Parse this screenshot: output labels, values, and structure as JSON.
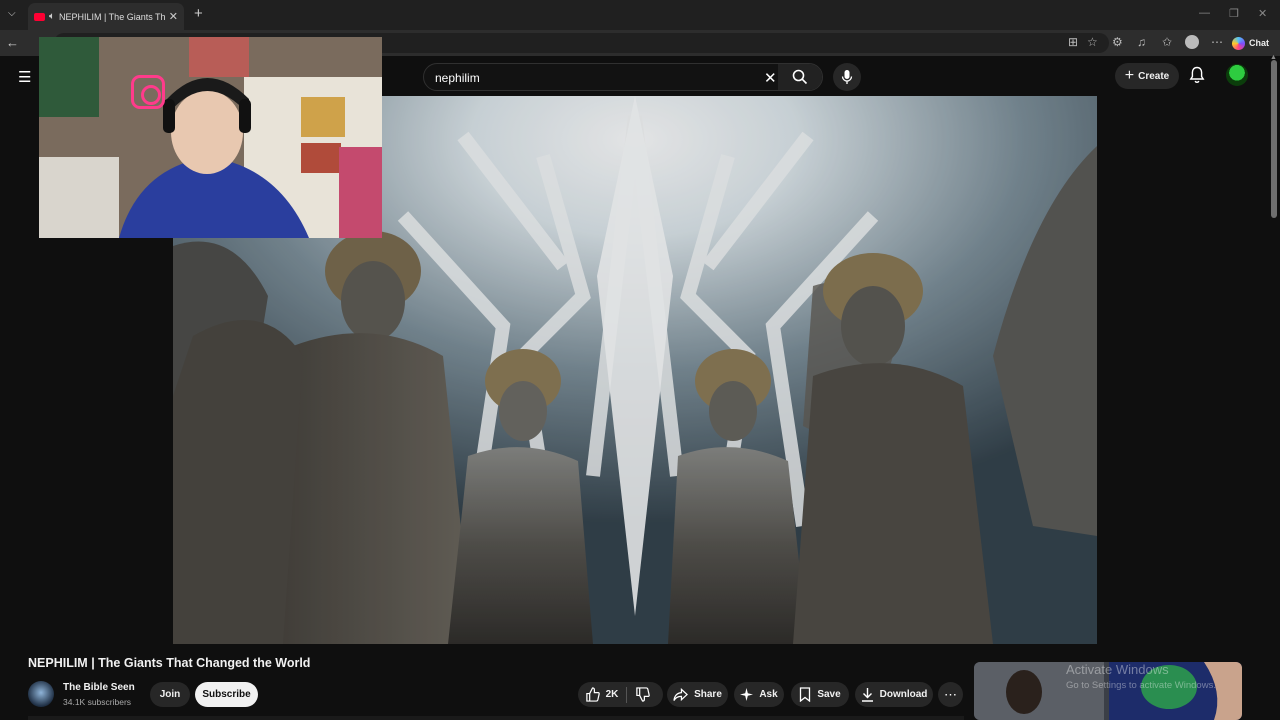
{
  "browser": {
    "tab_title": "NEPHILIM | The Giants That C",
    "tab_close": "✕",
    "new_tab": "+",
    "copilot_label": "Chat",
    "window_controls": [
      "—",
      "❐",
      "✕"
    ]
  },
  "youtube": {
    "search_query": "nephilim",
    "create_label": "Create"
  },
  "video": {
    "title": "NEPHILIM | The Giants That Changed the World",
    "channel_name": "The Bible Seen",
    "subscribers": "34.1K subscribers",
    "join_label": "Join",
    "subscribe_label": "Subscribe",
    "like_count": "2K",
    "share_label": "Share",
    "ask_label": "Ask",
    "save_label": "Save",
    "download_label": "Download"
  },
  "overlay": {
    "activate_title": "Activate Windows",
    "activate_sub": "Go to Settings to activate Windows."
  }
}
